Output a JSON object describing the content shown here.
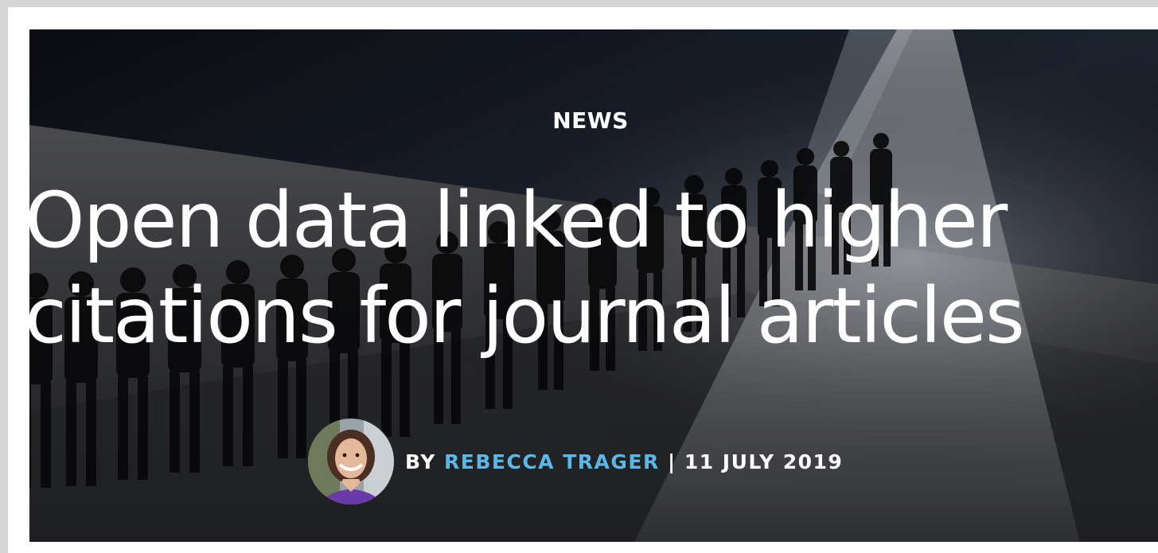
{
  "article": {
    "section_label": "NEWS",
    "headline_line1": "Open data linked to higher",
    "headline_line2": "citations for journal articles",
    "byline_prefix": "BY",
    "author": "REBECCA TRAGER",
    "separator": "|",
    "date": "11 JULY 2019"
  },
  "colors": {
    "background": "#d6d6d6",
    "hero_bg": "#1c1d22",
    "headline_text": "#ffffff",
    "author_link": "#5cb6e6"
  }
}
